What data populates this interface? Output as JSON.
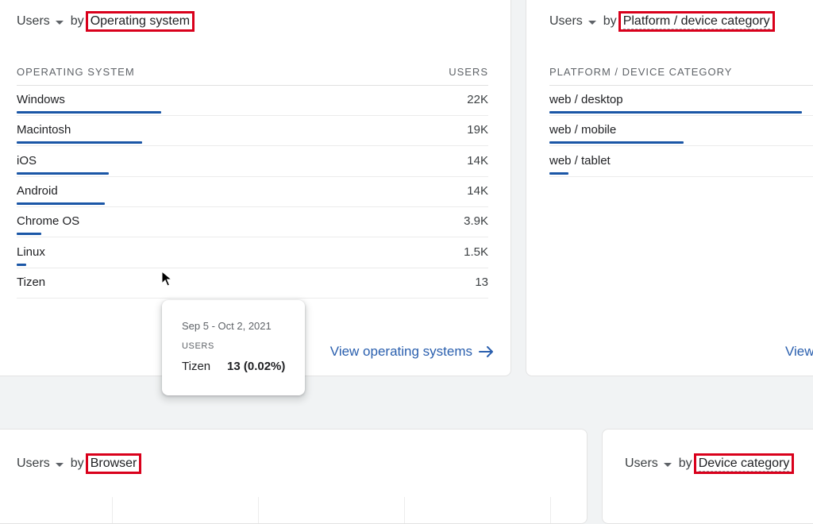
{
  "colors": {
    "bar": "#1a56a6",
    "link": "#2a5fae",
    "highlight_border": "#d9001b"
  },
  "os_card": {
    "metric": "Users",
    "by": "by",
    "dimension": "Operating system",
    "col_dimension": "OPERATING SYSTEM",
    "col_metric": "USERS",
    "rows": [
      {
        "label": "Windows",
        "value": "22K",
        "bar": 1.0
      },
      {
        "label": "Macintosh",
        "value": "19K",
        "bar": 0.87
      },
      {
        "label": "iOS",
        "value": "14K",
        "bar": 0.64
      },
      {
        "label": "Android",
        "value": "14K",
        "bar": 0.61
      },
      {
        "label": "Chrome OS",
        "value": "3.9K",
        "bar": 0.17
      },
      {
        "label": "Linux",
        "value": "1.5K",
        "bar": 0.065
      },
      {
        "label": "Tizen",
        "value": "13",
        "bar": 0
      }
    ],
    "view_link": "View operating systems",
    "link_icon": "arrow-right-icon"
  },
  "platform_card": {
    "metric": "Users",
    "by": "by",
    "dimension": "Platform / device category",
    "col_dimension": "PLATFORM / DEVICE CATEGORY",
    "rows": [
      {
        "label": "web / desktop",
        "bar": 1.0
      },
      {
        "label": "web / mobile",
        "bar": 0.53
      },
      {
        "label": "web / tablet",
        "bar": 0.075
      }
    ],
    "view_link": "View"
  },
  "browser_card": {
    "metric": "Users",
    "by": "by",
    "dimension": "Browser"
  },
  "device_card": {
    "metric": "Users",
    "by": "by",
    "dimension": "Device category"
  },
  "tooltip": {
    "date_range": "Sep 5 - Oct 2, 2021",
    "metric": "USERS",
    "name": "Tizen",
    "value": "13 (0.02%)"
  }
}
